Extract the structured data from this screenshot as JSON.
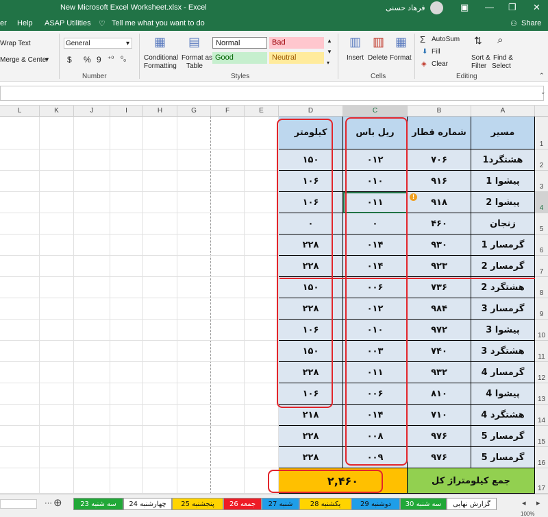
{
  "window": {
    "title": "New Microsoft Excel Worksheet.xlsx  -  Excel",
    "user": "فرهاد حسنی"
  },
  "menu": {
    "left_partial": "er",
    "help": "Help",
    "asap": "ASAP Utilities",
    "tell_me": "Tell me what you want to do",
    "share": "Share"
  },
  "ribbon": {
    "wrap_text": "Wrap Text",
    "merge_center": "Merge & Center",
    "number_format": "General",
    "currency": "$",
    "percent": "%",
    "comma": "9",
    "number_label": "Number",
    "conditional": "Conditional",
    "conditional2": "Formatting",
    "format_as": "Format as",
    "format_as2": "Table",
    "style_normal": "Normal",
    "style_bad": "Bad",
    "style_good": "Good",
    "style_neutral": "Neutral",
    "styles_label": "Styles",
    "insert": "Insert",
    "delete": "Delete",
    "format": "Format",
    "cells_label": "Cells",
    "autosum": "AutoSum",
    "fill": "Fill",
    "clear": "Clear",
    "sort_filter": "Sort &",
    "sort_filter2": "Filter",
    "find_select": "Find &",
    "find_select2": "Select",
    "editing_label": "Editing"
  },
  "columns": [
    "L",
    "K",
    "J",
    "I",
    "H",
    "G",
    "F",
    "E",
    "D",
    "C",
    "B",
    "A"
  ],
  "rows": [
    "1",
    "2",
    "3",
    "4",
    "5",
    "6",
    "7",
    "8",
    "9",
    "10",
    "11",
    "12",
    "13",
    "14",
    "15",
    "16",
    "17"
  ],
  "table": {
    "headers": {
      "route": "مسیر",
      "train": "شماره قطار",
      "railbus": "ریل باس",
      "km": "کیلومتر"
    },
    "data": [
      {
        "route": "هشتگرد1",
        "train": "۷۰۶",
        "railbus": "۰۱۲",
        "km": "۱۵۰"
      },
      {
        "route": "پیشوا 1",
        "train": "۹۱۶",
        "railbus": "۰۱۰",
        "km": "۱۰۶"
      },
      {
        "route": "پیشوا 2",
        "train": "۹۱۸",
        "railbus": "۰۱۱",
        "km": "۱۰۶"
      },
      {
        "route": "زنجان",
        "train": "۴۶۰",
        "railbus": "۰",
        "km": "۰"
      },
      {
        "route": "گرمسار 1",
        "train": "۹۳۰",
        "railbus": "۰۱۴",
        "km": "۲۲۸"
      },
      {
        "route": "گرمسار 2",
        "train": "۹۲۳",
        "railbus": "۰۱۴",
        "km": "۲۲۸"
      },
      {
        "route": "هشتگرد 2",
        "train": "۷۳۶",
        "railbus": "۰۰۶",
        "km": "۱۵۰"
      },
      {
        "route": "گرمسار 3",
        "train": "۹۸۴",
        "railbus": "۰۱۲",
        "km": "۲۲۸"
      },
      {
        "route": "پیشوا 3",
        "train": "۹۷۲",
        "railbus": "۰۱۰",
        "km": "۱۰۶"
      },
      {
        "route": "هشتگرد 3",
        "train": "۷۴۰",
        "railbus": "۰۰۳",
        "km": "۱۵۰"
      },
      {
        "route": "گرمسار 4",
        "train": "۹۳۲",
        "railbus": "۰۱۱",
        "km": "۲۲۸"
      },
      {
        "route": "پیشوا 4",
        "train": "۸۱۰",
        "railbus": "۰۰۶",
        "km": "۱۰۶"
      },
      {
        "route": "هشتگرد 4",
        "train": "۷۱۰",
        "railbus": "۰۱۴",
        "km": "۲۱۸"
      },
      {
        "route": "گرمسار 5",
        "train": "۹۷۶",
        "railbus": "۰۰۸",
        "km": "۲۲۸"
      },
      {
        "route": "گرمسار 5",
        "train": "۹۷۶",
        "railbus": "۰۰۹",
        "km": "۲۲۸"
      }
    ],
    "total_label": "جمع کیلومتراژ کل",
    "total_value": "۲,۴۶۰"
  },
  "sheet_tabs": [
    {
      "label": "سه شنبه 23",
      "color": "#21a838"
    },
    {
      "label": "چهارشنبه 24",
      "color": "#ffffff"
    },
    {
      "label": "پنجشنبه 25",
      "color": "#ffd400"
    },
    {
      "label": "جمعه 26",
      "color": "#ee1c25"
    },
    {
      "label": "شنبه 27",
      "color": "#1f9ee8"
    },
    {
      "label": "یکشنبه 28",
      "color": "#ffd400"
    },
    {
      "label": "دوشنبه 29",
      "color": "#1f9ee8"
    },
    {
      "label": "سه شنبه 30",
      "color": "#21a838"
    },
    {
      "label": "گزارش نهایی",
      "color": "#ffffff"
    }
  ],
  "status": {
    "zoom": "100%"
  }
}
